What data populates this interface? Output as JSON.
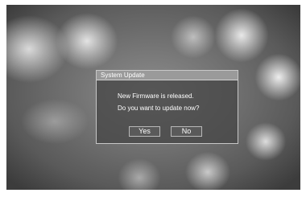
{
  "dialog": {
    "title": "System Update",
    "message_line1": "New Firmware is released.",
    "message_line2": "Do you want to update now?",
    "buttons": {
      "yes_label": "Yes",
      "no_label": "No"
    }
  },
  "colors": {
    "dialog_background": "#464646",
    "title_bar": "#9a9a9a",
    "text": "#ffffff",
    "border": "#c8c8c8"
  }
}
